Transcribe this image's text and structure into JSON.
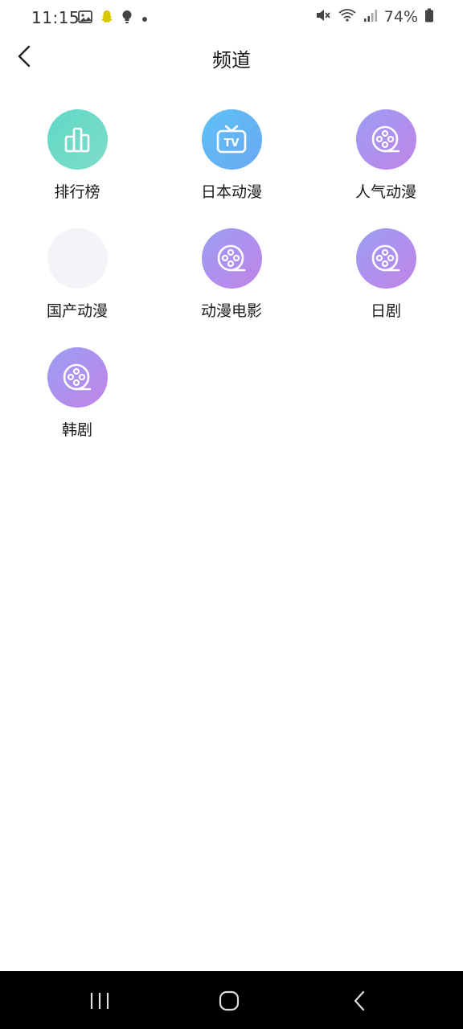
{
  "status_bar": {
    "time": "11:15",
    "battery": "74%"
  },
  "header": {
    "title": "频道"
  },
  "channels": [
    {
      "label": "排行榜",
      "icon": "bar-chart-icon",
      "color": "teal"
    },
    {
      "label": "日本动漫",
      "icon": "tv-icon",
      "color": "blue"
    },
    {
      "label": "人气动漫",
      "icon": "film-reel-icon",
      "color": "purple"
    },
    {
      "label": "国产动漫",
      "icon": "",
      "color": "empty"
    },
    {
      "label": "动漫电影",
      "icon": "film-reel-icon",
      "color": "purple"
    },
    {
      "label": "日剧",
      "icon": "film-reel-icon",
      "color": "purple"
    },
    {
      "label": "韩剧",
      "icon": "film-reel-icon",
      "color": "purple"
    }
  ],
  "colors": {
    "teal": "#5fd9c6",
    "blue": "#5ec1f4",
    "purple": "#ae90ee",
    "empty": "#f3f3f8"
  }
}
